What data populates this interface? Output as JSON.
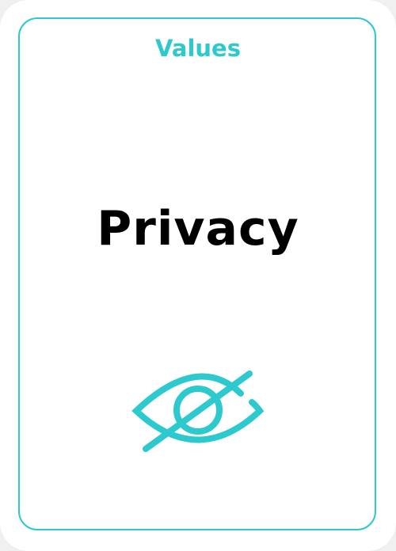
{
  "card": {
    "category": "Values",
    "title": "Privacy",
    "icon": "eye-slash-icon",
    "accent_color": "#2cc9cf"
  }
}
